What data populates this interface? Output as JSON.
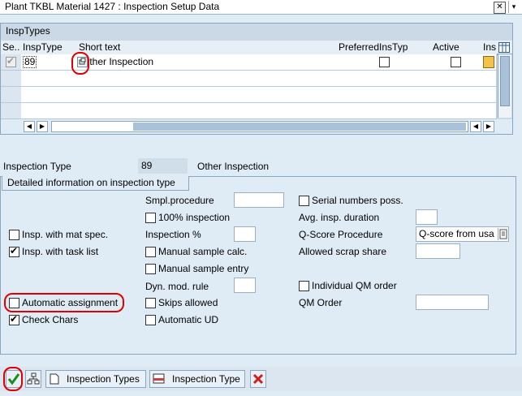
{
  "window": {
    "title": "Plant TKBL Material 1427 : Inspection Setup Data",
    "close_glyph": "✕",
    "menu_glyph": "▾"
  },
  "table": {
    "title": "InspTypes",
    "columns": [
      "Se..",
      "InspType",
      "Short text",
      "PreferredInsTyp",
      "Active",
      "Ins"
    ],
    "row1": {
      "insp_type": "89",
      "short_text": "Other Inspection"
    }
  },
  "form": {
    "insp_type_label": "Inspection Type",
    "insp_type_value": "89",
    "insp_type_desc": "Other Inspection",
    "section_title": "Detailed information on inspection type",
    "smpl_procedure": "Smpl.procedure",
    "inspection_100": "100% inspection",
    "inspection_pct": "Inspection %",
    "manual_sample_calc": "Manual sample calc.",
    "manual_sample_entry": "Manual sample entry",
    "dyn_mod_rule": "Dyn. mod. rule",
    "skips_allowed": "Skips allowed",
    "automatic_ud": "Automatic UD",
    "insp_mat_spec": "Insp. with mat spec.",
    "insp_task_list": "Insp. with task list",
    "automatic_assignment": "Automatic assignment",
    "check_chars": "Check Chars",
    "serial_numbers": "Serial numbers poss.",
    "avg_insp_duration": "Avg. insp. duration",
    "q_score_procedure": "Q-Score Procedure",
    "q_score_value": "Q-score from usa",
    "allowed_scrap": "Allowed scrap share",
    "individual_qm": "Individual QM order",
    "qm_order": "QM Order"
  },
  "toolbar": {
    "insp_types_btn": "Inspection Types",
    "insp_type_btn": "Inspection Type"
  }
}
